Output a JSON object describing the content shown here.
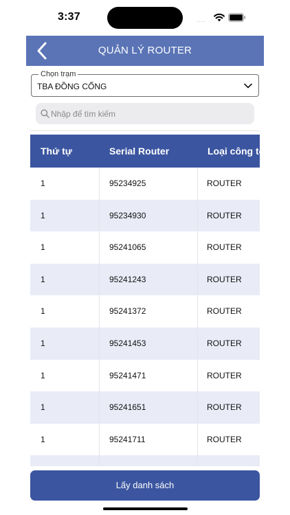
{
  "status_bar": {
    "time": "3:37",
    "signal": "....",
    "icons": [
      "wifi-icon",
      "battery-icon"
    ]
  },
  "header": {
    "title": "QUẢN LÝ ROUTER",
    "back_icon": "chevron-left-icon",
    "background": "#5a74b6"
  },
  "station_select": {
    "label": "Chọn trạm",
    "value": "TBA ĐỒNG CỐNG"
  },
  "search": {
    "placeholder": "Nhập để tìm kiếm",
    "value": ""
  },
  "table": {
    "header_color": "#3b55a0",
    "columns": [
      "Thứ tự",
      "Serial Router",
      "Loại công tơ"
    ],
    "rows": [
      [
        "1",
        "95234925",
        "ROUTER"
      ],
      [
        "1",
        "95234930",
        "ROUTER"
      ],
      [
        "1",
        "95241065",
        "ROUTER"
      ],
      [
        "1",
        "95241243",
        "ROUTER"
      ],
      [
        "1",
        "95241372",
        "ROUTER"
      ],
      [
        "1",
        "95241453",
        "ROUTER"
      ],
      [
        "1",
        "95241471",
        "ROUTER"
      ],
      [
        "1",
        "95241651",
        "ROUTER"
      ],
      [
        "1",
        "95241711",
        "ROUTER"
      ],
      [
        "",
        "",
        ""
      ]
    ]
  },
  "footer": {
    "button_label": "Lấy danh sách"
  }
}
